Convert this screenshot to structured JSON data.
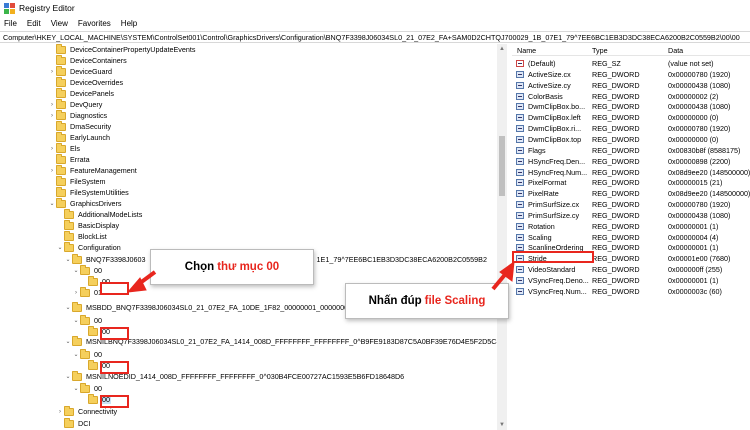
{
  "window": {
    "title": "Registry Editor"
  },
  "menu": [
    "File",
    "Edit",
    "View",
    "Favorites",
    "Help"
  ],
  "address": "Computer\\HKEY_LOCAL_MACHINE\\SYSTEM\\ControlSet001\\Control\\GraphicsDrivers\\Configuration\\BNQ7F3398J06034SL0_21_07E2_FA+SAM0D2CHTQJ700029_1B_07E1_79^7EE6BC1EB3D3DC38ECA6200B2C0559B2\\00\\00",
  "tree": [
    {
      "label": "DeviceContainerPropertyUpdateEvents",
      "exp": ""
    },
    {
      "label": "DeviceContainers",
      "exp": ""
    },
    {
      "label": "DeviceGuard",
      "exp": "›"
    },
    {
      "label": "DeviceOverrides",
      "exp": ""
    },
    {
      "label": "DevicePanels",
      "exp": ""
    },
    {
      "label": "DevQuery",
      "exp": "›"
    },
    {
      "label": "Diagnostics",
      "exp": "›"
    },
    {
      "label": "DmaSecurity",
      "exp": ""
    },
    {
      "label": "EarlyLaunch",
      "exp": ""
    },
    {
      "label": "Els",
      "exp": "›"
    },
    {
      "label": "Errata",
      "exp": ""
    },
    {
      "label": "FeatureManagement",
      "exp": "›"
    },
    {
      "label": "FileSystem",
      "exp": ""
    },
    {
      "label": "FileSystemUtilities",
      "exp": ""
    },
    {
      "label": "GraphicsDrivers",
      "exp": "⌄"
    },
    {
      "label": "AdditionalModeLists",
      "exp": ""
    },
    {
      "label": "BasicDisplay",
      "exp": ""
    },
    {
      "label": "BlockList",
      "exp": ""
    },
    {
      "label": "Configuration",
      "exp": "⌄"
    },
    {
      "label": "BNQ7F3398J0603",
      "suffix": "1E1_79^7EE6BC1EB3D3DC38ECA6200B2C0559B2",
      "exp": "⌄"
    },
    {
      "label": "00",
      "exp": "⌄"
    },
    {
      "label": "00",
      "exp": ""
    },
    {
      "label": "01",
      "exp": "›"
    },
    {
      "label": "MSBDD_BNQ7F3398J06034SL0_21_07E2_FA_10DE_1F82_00000001_00000000_0",
      "exp": "⌄"
    },
    {
      "label": "00",
      "exp": "⌄"
    },
    {
      "label": "00",
      "exp": ""
    },
    {
      "label": "MSNILBNQ7F3398J06034SL0_21_07E2_FA_1414_008D_FFFFFFFF_FFFFFFFF_0^B9FE9183D87C5A0BF39E76D4E5F2D5C8",
      "exp": "⌄"
    },
    {
      "label": "00",
      "exp": "⌄"
    },
    {
      "label": "00",
      "exp": ""
    },
    {
      "label": "MSNILNOEDID_1414_008D_FFFFFFFF_FFFFFFFF_0^030B4FCE00727AC1593E5B6FD18648D6",
      "exp": "⌄"
    },
    {
      "label": "00",
      "exp": "⌄"
    },
    {
      "label": "00",
      "exp": ""
    },
    {
      "label": "Connectivity",
      "exp": "›"
    },
    {
      "label": "DCI",
      "exp": ""
    }
  ],
  "values": {
    "headers": {
      "name": "Name",
      "type": "Type",
      "data": "Data"
    },
    "rows": [
      {
        "name": "(Default)",
        "type": "REG_SZ",
        "data": "(value not set)",
        "icon": "string-value-icon"
      },
      {
        "name": "ActiveSize.cx",
        "type": "REG_DWORD",
        "data": "0x00000780 (1920)",
        "icon": "dword-value-icon"
      },
      {
        "name": "ActiveSize.cy",
        "type": "REG_DWORD",
        "data": "0x00000438 (1080)",
        "icon": "dword-value-icon"
      },
      {
        "name": "ColorBasis",
        "type": "REG_DWORD",
        "data": "0x00000002 (2)",
        "icon": "dword-value-icon"
      },
      {
        "name": "DwmClipBox.bo...",
        "type": "REG_DWORD",
        "data": "0x00000438 (1080)",
        "icon": "dword-value-icon"
      },
      {
        "name": "DwmClipBox.left",
        "type": "REG_DWORD",
        "data": "0x00000000 (0)",
        "icon": "dword-value-icon"
      },
      {
        "name": "DwmClipBox.ri...",
        "type": "REG_DWORD",
        "data": "0x00000780 (1920)",
        "icon": "dword-value-icon"
      },
      {
        "name": "DwmClipBox.top",
        "type": "REG_DWORD",
        "data": "0x00000000 (0)",
        "icon": "dword-value-icon"
      },
      {
        "name": "Flags",
        "type": "REG_DWORD",
        "data": "0x00830b8f (8588175)",
        "icon": "dword-value-icon"
      },
      {
        "name": "HSyncFreq.Den...",
        "type": "REG_DWORD",
        "data": "0x00000898 (2200)",
        "icon": "dword-value-icon"
      },
      {
        "name": "HSyncFreq.Num...",
        "type": "REG_DWORD",
        "data": "0x08d9ee20 (148500000)",
        "icon": "dword-value-icon"
      },
      {
        "name": "PixelFormat",
        "type": "REG_DWORD",
        "data": "0x00000015 (21)",
        "icon": "dword-value-icon"
      },
      {
        "name": "PixelRate",
        "type": "REG_DWORD",
        "data": "0x08d9ee20 (148500000)",
        "icon": "dword-value-icon"
      },
      {
        "name": "PrimSurfSize.cx",
        "type": "REG_DWORD",
        "data": "0x00000780 (1920)",
        "icon": "dword-value-icon"
      },
      {
        "name": "PrimSurfSize.cy",
        "type": "REG_DWORD",
        "data": "0x00000438 (1080)",
        "icon": "dword-value-icon"
      },
      {
        "name": "Rotation",
        "type": "REG_DWORD",
        "data": "0x00000001 (1)",
        "icon": "dword-value-icon"
      },
      {
        "name": "Scaling",
        "type": "REG_DWORD",
        "data": "0x00000004 (4)",
        "icon": "dword-value-icon"
      },
      {
        "name": "ScanlineOrdering",
        "type": "REG_DWORD",
        "data": "0x00000001 (1)",
        "icon": "dword-value-icon"
      },
      {
        "name": "Stride",
        "type": "REG_DWORD",
        "data": "0x00001e00 (7680)",
        "icon": "dword-value-icon"
      },
      {
        "name": "VideoStandard",
        "type": "REG_DWORD",
        "data": "0x000000ff (255)",
        "icon": "dword-value-icon"
      },
      {
        "name": "VSyncFreq.Deno...",
        "type": "REG_DWORD",
        "data": "0x00000001 (1)",
        "icon": "dword-value-icon"
      },
      {
        "name": "VSyncFreq.Num...",
        "type": "REG_DWORD",
        "data": "0x0000003c (60)",
        "icon": "dword-value-icon"
      }
    ]
  },
  "callouts": {
    "folder": {
      "text": "Chọn",
      "highlight": "thư mục 00"
    },
    "file": {
      "text": "Nhấn đúp",
      "highlight": "file Scaling"
    }
  },
  "colors": {
    "accent": "#e8261e",
    "selection": "#cce4f7",
    "folder": "#f5cf5c"
  }
}
